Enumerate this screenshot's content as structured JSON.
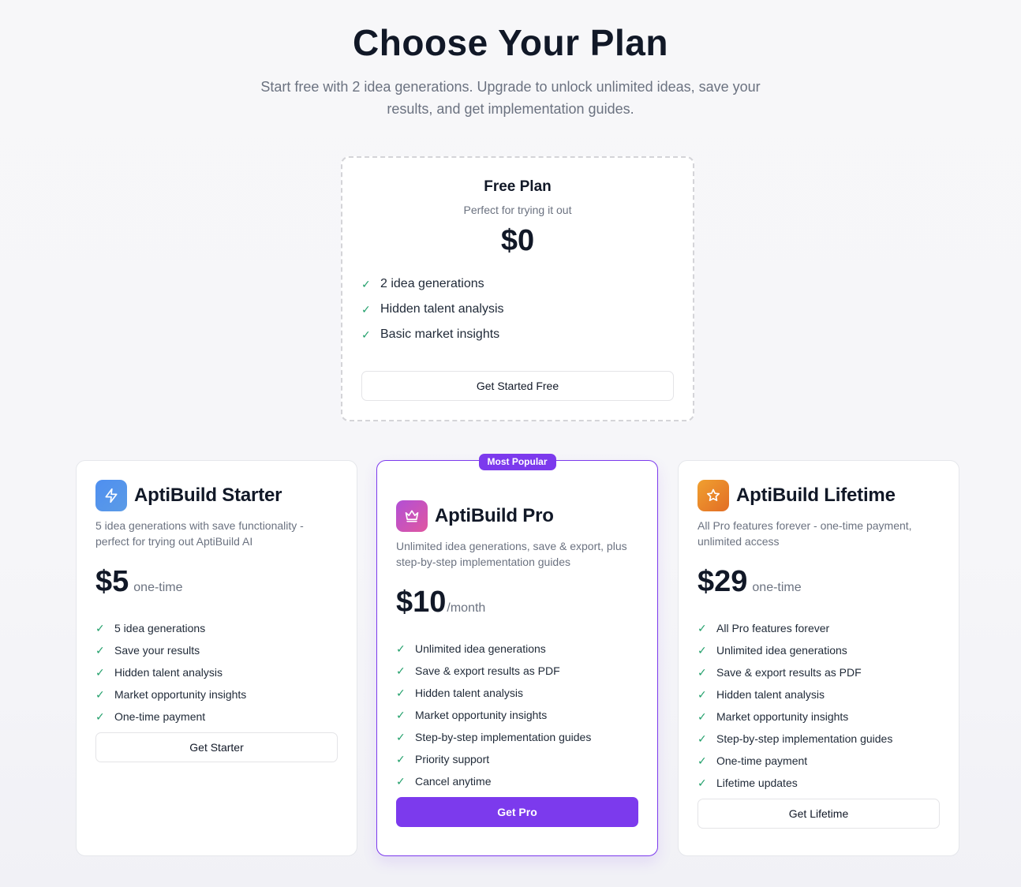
{
  "header": {
    "title": "Choose Your Plan",
    "subtitle": "Start free with 2 idea generations. Upgrade to unlock unlimited ideas, save your results, and get implementation guides."
  },
  "free_plan": {
    "title": "Free Plan",
    "description": "Perfect for trying it out",
    "price": "$0",
    "features": [
      "2 idea generations",
      "Hidden talent analysis",
      "Basic market insights"
    ],
    "button_label": "Get Started Free"
  },
  "plans": [
    {
      "name": "AptiBuild Starter",
      "icon": "lightning-icon",
      "description": "5 idea generations with save functionality - perfect for trying out AptiBuild AI",
      "price": "$5",
      "period": "one-time",
      "features": [
        "5 idea generations",
        "Save your results",
        "Hidden talent analysis",
        "Market opportunity insights",
        "One-time payment"
      ],
      "button_label": "Get Starter"
    },
    {
      "name": "AptiBuild Pro",
      "icon": "crown-icon",
      "badge": "Most Popular",
      "description": "Unlimited idea generations, save & export, plus step-by-step implementation guides",
      "price": "$10",
      "period": "/month",
      "features": [
        "Unlimited idea generations",
        "Save & export results as PDF",
        "Hidden talent analysis",
        "Market opportunity insights",
        "Step-by-step implementation guides",
        "Priority support",
        "Cancel anytime"
      ],
      "button_label": "Get Pro"
    },
    {
      "name": "AptiBuild Lifetime",
      "icon": "star-icon",
      "description": "All Pro features forever - one-time payment, unlimited access",
      "price": "$29",
      "period": "one-time",
      "features": [
        "All Pro features forever",
        "Unlimited idea generations",
        "Save & export results as PDF",
        "Hidden talent analysis",
        "Market opportunity insights",
        "Step-by-step implementation guides",
        "One-time payment",
        "Lifetime updates"
      ],
      "button_label": "Get Lifetime"
    }
  ],
  "colors": {
    "accent": "#7c3aed",
    "check": "#22a06b",
    "text": "#111827",
    "muted": "#6b7280"
  }
}
